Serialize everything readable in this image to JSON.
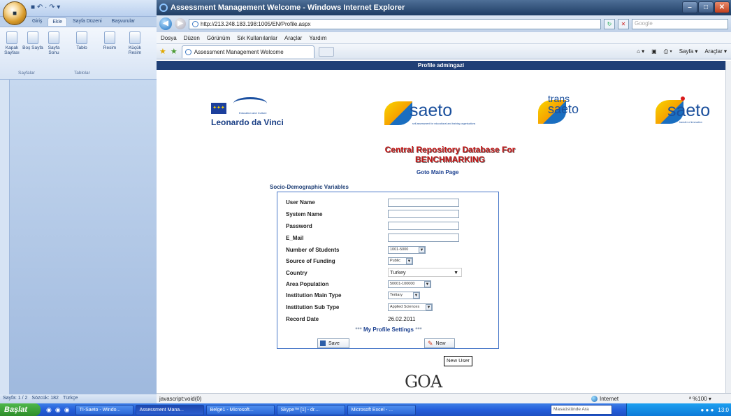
{
  "word": {
    "quick_access": "■ ↶ · ↷ ▾",
    "tabs": [
      "Giriş",
      "Ekle",
      "Sayfa Düzeni",
      "Başvurular"
    ],
    "ribbon_buttons": [
      {
        "label": "Kapak Sayfası"
      },
      {
        "label": "Boş Sayfa"
      },
      {
        "label": "Sayfa Sonu"
      },
      {
        "label": "Tablo"
      },
      {
        "label": "Resim"
      },
      {
        "label": "Küçük Resim"
      }
    ],
    "groups": [
      "Sayfalar",
      "Tablolar"
    ],
    "status": {
      "page": "Sayfa: 1 / 2",
      "words": "Sözcük: 182",
      "lang": "Türkçe"
    }
  },
  "ie": {
    "title": "Assessment Management Welcome - Windows Internet Explorer",
    "address": "http://213.248.183.198:1005/EN/Profile.aspx",
    "search_placeholder": "Google",
    "menu": [
      "Dosya",
      "Düzen",
      "Görünüm",
      "Sık Kullanılanlar",
      "Araçlar",
      "Yardım"
    ],
    "tab_title": "Assessment Management Welcome",
    "cmd": [
      "Sayfa ▾",
      "Araçlar ▾"
    ],
    "status_text": "javascript:void(0)",
    "zone": "Internet",
    "zoom": "ª %100 ▾"
  },
  "page": {
    "header": "Profile admingazi",
    "eu_caption": "Education and Culture",
    "leonardo": "Leonardo da Vinci",
    "saeto": "saeto",
    "saeto_sub": "self-assessment for educational and training organisations",
    "trans": "trans",
    "saeto2": "saeto",
    "saeto3": "saeto",
    "saeto3_sub": "transfer of innovation",
    "central_title": "Central Repository Database For BENCHMARKING",
    "goto_link": "Goto Main Page",
    "section_title": "Socio-Demographic Variables",
    "form": {
      "user_name": "User Name",
      "system_name": "System Name",
      "password": "Password",
      "email": "E_Mail",
      "students": "Number of Students",
      "students_value": "1001-5000",
      "funding": "Source of Funding",
      "funding_value": "Public",
      "country": "Country",
      "country_value": "Turkey",
      "area": "Area Population",
      "area_value": "50001-100000",
      "main_type": "Institution Main Type",
      "main_type_value": "Tertiary",
      "sub_type": "Institution Sub Type",
      "sub_type_value": "Applied Sciences",
      "record_date": "Record Date",
      "record_date_value": "26.02.2011",
      "profile_settings": "My Profile Settings",
      "save": "Save",
      "new": "New"
    },
    "tooltip": "New User",
    "goa": "GOA"
  },
  "taskbar": {
    "start": "Başlat",
    "items": [
      {
        "label": "TI-Saeto - Windo...",
        "active": false
      },
      {
        "label": "Assessment Mana...",
        "active": true
      },
      {
        "label": "Belge1 - Microsoft...",
        "active": false
      },
      {
        "label": "Skype™ [1] - dr....",
        "active": false
      },
      {
        "label": "Microsoft Excel - ...",
        "active": false
      }
    ],
    "search": "Masaüstünde Ara",
    "clock": "13:0"
  }
}
